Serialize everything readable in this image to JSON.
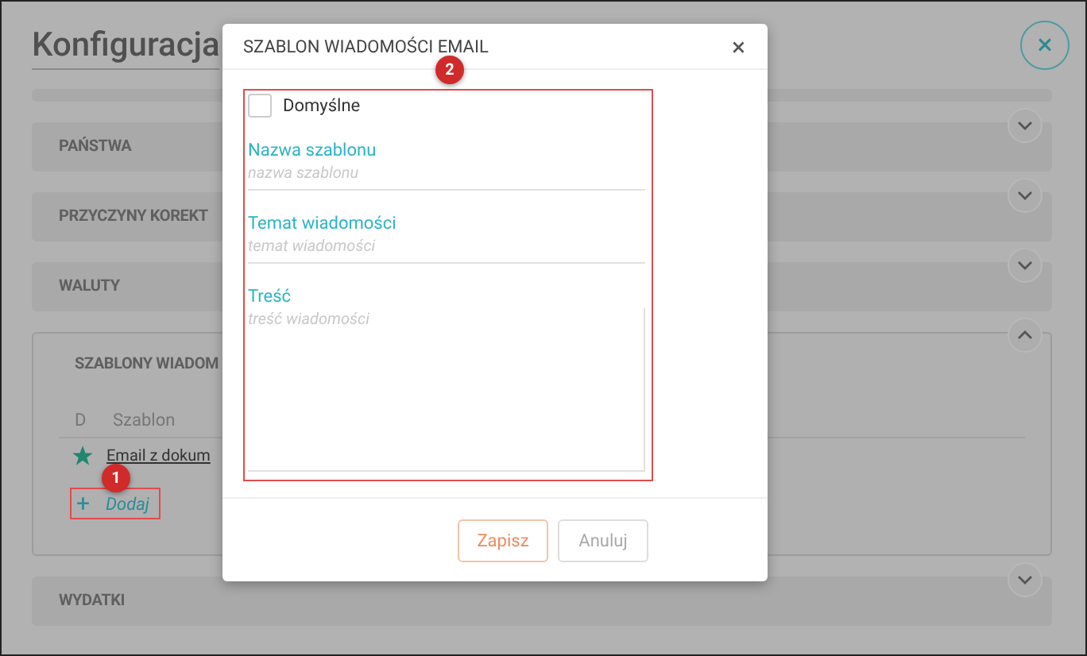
{
  "page": {
    "title": "Konfiguracja",
    "close_button": "×"
  },
  "sections": [
    {
      "kind": "strip"
    },
    {
      "kind": "panel",
      "label": "PAŃSTWA",
      "expanded": false
    },
    {
      "kind": "panel",
      "label": "PRZYCZYNY KOREKT",
      "expanded": false
    },
    {
      "kind": "panel",
      "label": "WALUTY",
      "expanded": false
    },
    {
      "kind": "panel",
      "label": "SZABLONY WIADOM",
      "expanded": true,
      "table": {
        "columns": [
          "D",
          "Szablon"
        ],
        "rows": [
          {
            "default": true,
            "name": "Email z dokum"
          }
        ]
      },
      "add_button": {
        "icon": "+",
        "label": "Dodaj"
      }
    },
    {
      "kind": "panel",
      "label": "WYDATKI",
      "expanded": false
    }
  ],
  "dialog": {
    "title": "SZABLON WIADOMOŚCI EMAIL",
    "close": "×",
    "checkbox": {
      "label": "Domyślne",
      "checked": false
    },
    "fields": [
      {
        "kind": "input",
        "label": "Nazwa szablonu",
        "placeholder": "nazwa szablonu"
      },
      {
        "kind": "input",
        "label": "Temat wiadomości",
        "placeholder": "temat wiadomości"
      },
      {
        "kind": "textarea",
        "label": "Treść",
        "placeholder": "treść wiadomości"
      }
    ],
    "buttons": [
      {
        "label": "Zapisz",
        "kind": "primary"
      },
      {
        "label": "Anuluj",
        "kind": "secondary"
      }
    ]
  },
  "annotations": [
    {
      "number": "1"
    },
    {
      "number": "2"
    }
  ]
}
